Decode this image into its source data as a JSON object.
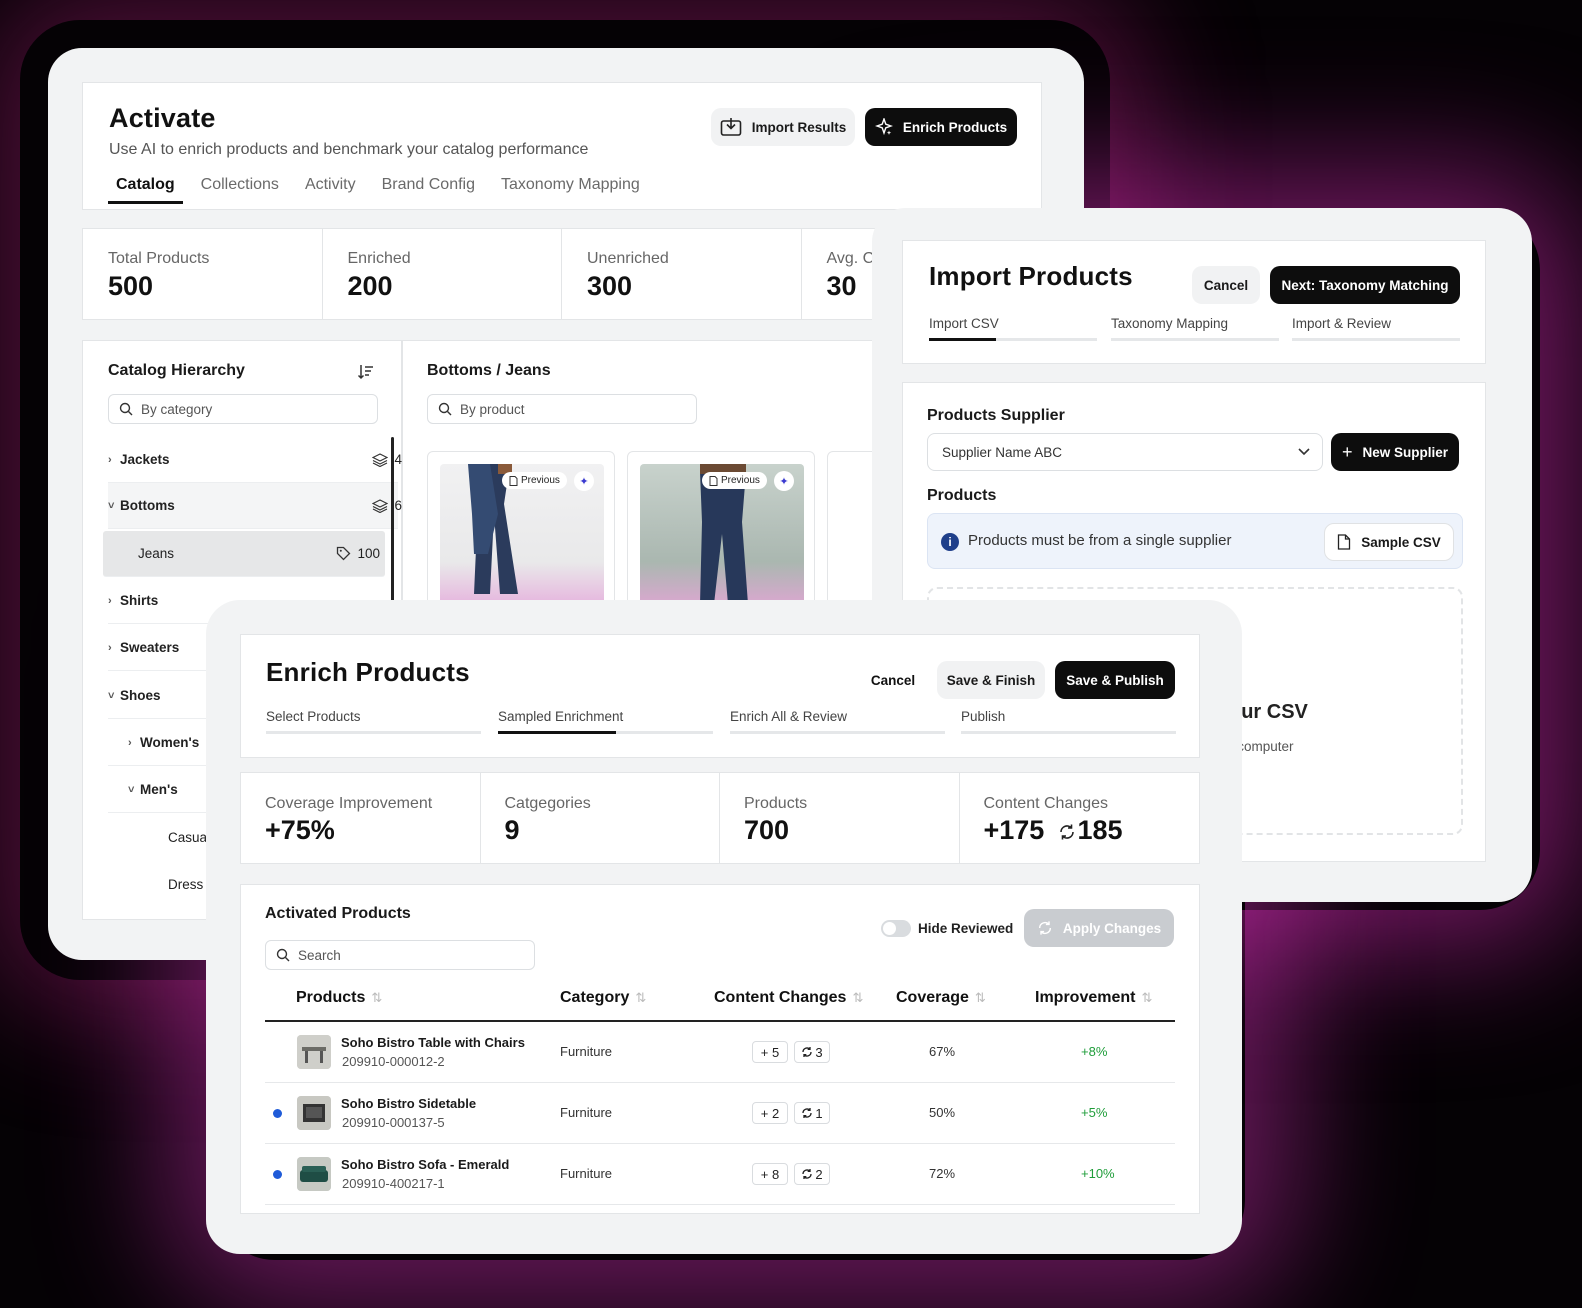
{
  "activate": {
    "title": "Activate",
    "subtitle": "Use AI to enrich products and benchmark your catalog performance",
    "import_results_label": "Import Results",
    "enrich_products_label": "Enrich Products",
    "tabs": [
      "Catalog",
      "Collections",
      "Activity",
      "Brand Config",
      "Taxonomy Mapping"
    ],
    "stats": [
      {
        "label": "Total Products",
        "value": "500"
      },
      {
        "label": "Enriched",
        "value": "200"
      },
      {
        "label": "Unenriched",
        "value": "300"
      },
      {
        "label": "Avg. C",
        "value": "30"
      }
    ],
    "hierarchy": {
      "title": "Catalog Hierarchy",
      "search_placeholder": "By category",
      "items": [
        {
          "label": "Jackets",
          "chev": "›",
          "count": "4"
        },
        {
          "label": "Bottoms",
          "chev": "˅",
          "count": "6"
        },
        {
          "label": "Jeans",
          "count": "100"
        },
        {
          "label": "Shirts",
          "chev": "›"
        },
        {
          "label": "Sweaters",
          "chev": "›"
        },
        {
          "label": "Shoes",
          "chev": "˅"
        },
        {
          "label": "Women's",
          "chev": "›"
        },
        {
          "label": "Men's",
          "chev": "˅"
        },
        {
          "label": "Casua"
        },
        {
          "label": "Dress"
        }
      ]
    },
    "products": {
      "title": "Bottoms / Jeans",
      "search_placeholder": "By product",
      "card_pill": "Previous"
    }
  },
  "import": {
    "title": "Import Products",
    "cancel_label": "Cancel",
    "next_label": "Next: Taxonomy Matching",
    "steps": [
      "Import CSV",
      "Taxonomy Mapping",
      "Import & Review"
    ],
    "step_progress": [
      0.4,
      0,
      0
    ],
    "supplier_heading": "Products Supplier",
    "supplier_value": "Supplier Name ABC",
    "new_supplier_label": "New Supplier",
    "products_heading": "Products",
    "info_text": "Products must be from a single supplier",
    "sample_csv_label": "Sample CSV",
    "drop_title": "our CSV",
    "drop_sub": "r computer"
  },
  "enrich": {
    "title": "Enrich Products",
    "cancel_label": "Cancel",
    "save_finish_label": "Save & Finish",
    "save_publish_label": "Save & Publish",
    "steps": [
      "Select Products",
      "Sampled Enrichment",
      "Enrich All & Review",
      "Publish"
    ],
    "step_progress": [
      0,
      0.55,
      0,
      0
    ],
    "stats": [
      {
        "label": "Coverage Improvement",
        "value": "+75%"
      },
      {
        "label": "Catgegories",
        "value": "9"
      },
      {
        "label": "Products",
        "value": "700"
      },
      {
        "label": "Content Changes",
        "value": "+175",
        "value2": "185"
      }
    ],
    "table": {
      "title": "Activated Products",
      "search_placeholder": "Search",
      "hide_reviewed_label": "Hide Reviewed",
      "apply_changes_label": "Apply Changes",
      "headers": [
        "Products",
        "Category",
        "Content Changes",
        "Coverage",
        "Improvement"
      ],
      "rows": [
        {
          "name": "Soho Bistro Table with Chairs",
          "sku": "209910-000012-2",
          "category": "Furniture",
          "added": "+ 5",
          "changed": "3",
          "coverage": "67%",
          "improvement": "+8%",
          "dot": false
        },
        {
          "name": "Soho Bistro Sidetable",
          "sku": "209910-000137-5",
          "category": "Furniture",
          "added": "+ 2",
          "changed": "1",
          "coverage": "50%",
          "improvement": "+5%",
          "dot": true
        },
        {
          "name": "Soho Bistro Sofa - Emerald",
          "sku": "209910-400217-1",
          "category": "Furniture",
          "added": "+ 8",
          "changed": "2",
          "coverage": "72%",
          "improvement": "+10%",
          "dot": true
        }
      ]
    }
  },
  "colors": {
    "accent_dark": "#0d0d0d",
    "positive": "#1f9d3a",
    "info": "#1f3f8a",
    "unread_dot": "#1f5bd8",
    "glow": "#d23cc0"
  }
}
